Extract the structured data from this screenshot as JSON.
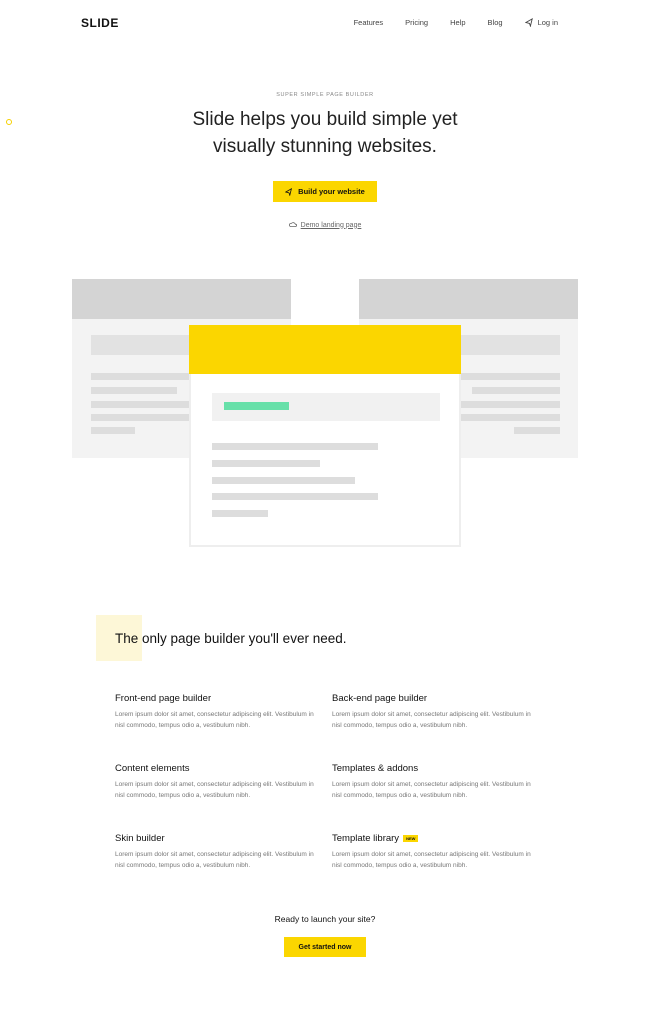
{
  "header": {
    "logo": "SLIDE",
    "nav": [
      "Features",
      "Pricing",
      "Help",
      "Blog"
    ],
    "login": "Log in"
  },
  "hero": {
    "eyebrow": "SUPER SIMPLE PAGE BUILDER",
    "headline_line1": "Slide helps you build simple yet",
    "headline_line2": "visually stunning websites.",
    "cta": "Build your website",
    "demo_link": "Demo landing page"
  },
  "features": {
    "title": "The only page builder you'll ever need.",
    "items": [
      {
        "title": "Front-end page builder",
        "text": "Lorem ipsum dolor sit amet, consectetur adipiscing elit. Vestibulum in nisl commodo, tempus odio a, vestibulum nibh."
      },
      {
        "title": "Back-end page builder",
        "text": "Lorem ipsum dolor sit amet, consectetur adipiscing elit. Vestibulum in nisl commodo, tempus odio a, vestibulum nibh."
      },
      {
        "title": "Content elements",
        "text": "Lorem ipsum dolor sit amet, consectetur adipiscing elit. Vestibulum in nisl commodo, tempus odio a, vestibulum nibh."
      },
      {
        "title": "Templates & addons",
        "text": "Lorem ipsum dolor sit amet, consectetur adipiscing elit. Vestibulum in nisl commodo, tempus odio a, vestibulum nibh."
      },
      {
        "title": "Skin builder",
        "text": "Lorem ipsum dolor sit amet, consectetur adipiscing elit. Vestibulum in nisl commodo, tempus odio a, vestibulum nibh."
      },
      {
        "title": "Template library",
        "badge": "NEW",
        "text": "Lorem ipsum dolor sit amet, consectetur adipiscing elit. Vestibulum in nisl commodo, tempus odio a, vestibulum nibh."
      }
    ]
  },
  "cta": {
    "text": "Ready to launch your site?",
    "button": "Get started now"
  },
  "colors": {
    "accent": "#fbd600",
    "green": "#67e0a9"
  }
}
